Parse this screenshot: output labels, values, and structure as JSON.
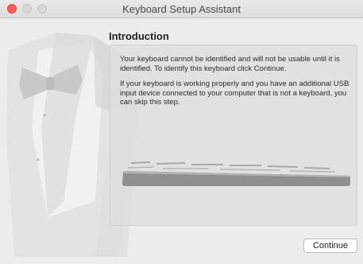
{
  "window": {
    "title": "Keyboard Setup Assistant"
  },
  "content": {
    "heading": "Introduction",
    "paragraph1": "Your keyboard cannot be identified and will not be usable until it is identified. To identify this keyboard click Continue.",
    "paragraph2": "If your keyboard is working properly and you have an additional USB input device connected to your computer that is not a keyboard, you can skip this step."
  },
  "buttons": {
    "continue_label": "Continue"
  },
  "icons": {
    "close": "close-icon",
    "minimize": "minimize-icon",
    "zoom": "zoom-icon",
    "illustration": "tuxedo-illustration",
    "keyboard": "keyboard-illustration"
  },
  "colors": {
    "close": "#fe5f57",
    "inactive_light": "#d7d7d7",
    "window_bg": "#ececec"
  }
}
